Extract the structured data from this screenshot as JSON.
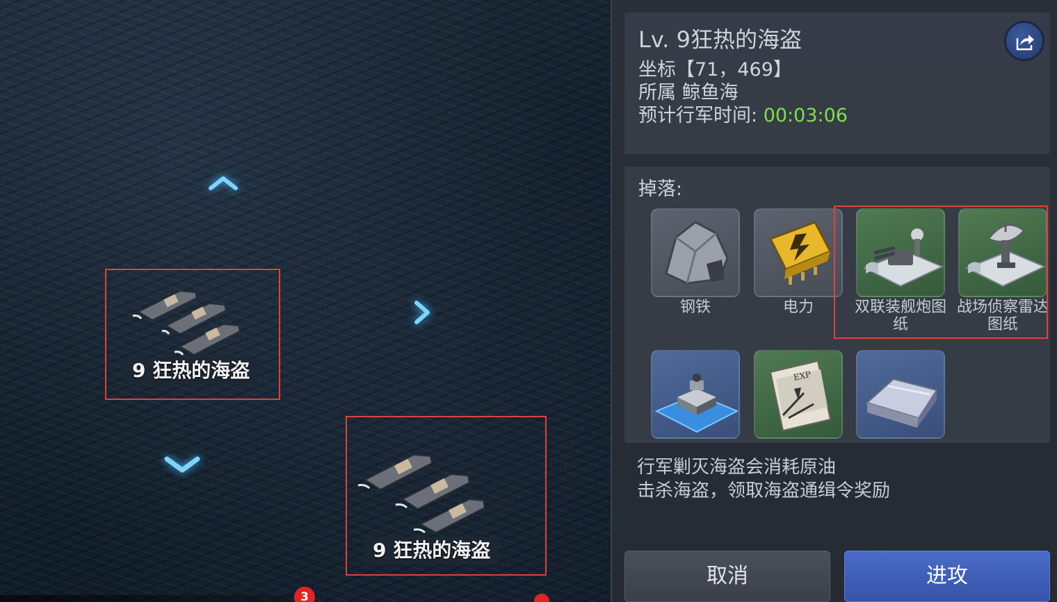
{
  "map": {
    "pirate_fleets": [
      {
        "label": "9 狂热的海盗"
      },
      {
        "label": "9 狂热的海盗"
      }
    ],
    "notification_badge": "3",
    "arrows": [
      "up",
      "right",
      "down"
    ]
  },
  "panel": {
    "title": "Lv. 9狂热的海盗",
    "coordinates": "坐标【71，469】",
    "belongs": "所属 鲸鱼海",
    "march_time_label": "预计行军时间: ",
    "march_time_value": "00:03:06",
    "drops_label": "掉落:",
    "drops": [
      {
        "name": "钢铁",
        "icon": "steel-ore-icon"
      },
      {
        "name": "电力",
        "icon": "battery-icon"
      },
      {
        "name": "双联装舰炮图纸",
        "icon": "twin-gun-blueprint-icon"
      },
      {
        "name": "战场侦察雷达图纸",
        "icon": "radar-blueprint-icon"
      },
      {
        "name": "",
        "icon": "base-building-icon"
      },
      {
        "name": "",
        "icon": "exp-document-icon"
      },
      {
        "name": "",
        "icon": "metal-ingot-icon"
      }
    ],
    "description_line1": "行军剿灭海盗会消耗原油",
    "description_line2": "击杀海盗，领取海盗通缉令奖励",
    "cancel_label": "取消",
    "attack_label": "进攻"
  },
  "colors": {
    "highlight": "#e0423a",
    "time_green": "#7ee04a",
    "attack_blue": "#3f5fbe"
  }
}
